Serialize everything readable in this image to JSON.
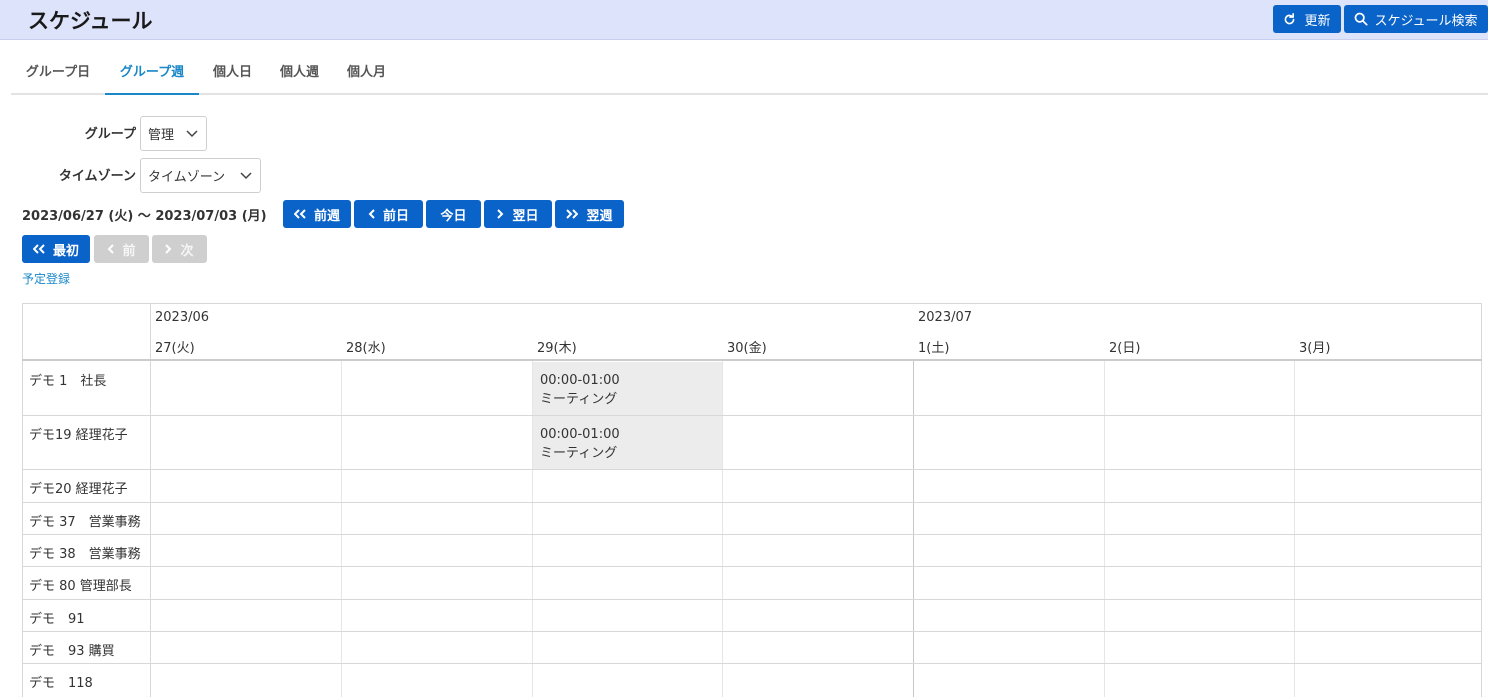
{
  "header": {
    "title": "スケジュール",
    "refresh_label": "更新",
    "search_label": "スケジュール検索"
  },
  "tabs": [
    {
      "label": "グループ日",
      "active": false
    },
    {
      "label": "グループ週",
      "active": true
    },
    {
      "label": "個人日",
      "active": false
    },
    {
      "label": "個人週",
      "active": false
    },
    {
      "label": "個人月",
      "active": false
    }
  ],
  "filters": {
    "group_label": "グループ",
    "group_value": "管理",
    "timezone_label": "タイムゾーン",
    "timezone_value": "タイムゾーン"
  },
  "nav": {
    "date_range": "2023/06/27 (火) ～ 2023/07/03 (月)",
    "prev_week": "前週",
    "prev_day": "前日",
    "today": "今日",
    "next_day": "翌日",
    "next_week": "翌週"
  },
  "paging": {
    "first": "最初",
    "prev": "前",
    "next": "次"
  },
  "register_link": "予定登録",
  "colors": {
    "primary": "#0a63c9",
    "header_bg": "#dde3fb",
    "active_tab": "#1a87c9",
    "event_bg": "#ececec",
    "disabled": "#cfcfcf"
  },
  "calendar": {
    "months": [
      "2023/06",
      "2023/07"
    ],
    "days": [
      "27(火)",
      "28(水)",
      "29(木)",
      "30(金)",
      "1(土)",
      "2(日)",
      "3(月)"
    ],
    "people": [
      "デモ 1　社長",
      "デモ19 経理花子",
      "デモ20 経理花子",
      "デモ 37　営業事務",
      "デモ 38　営業事務",
      "デモ 80 管理部長",
      "デモ　91",
      "デモ　93 購買",
      "デモ　118"
    ],
    "events": [
      {
        "person": 0,
        "day": 2,
        "time": "00:00-01:00",
        "title": "ミーティング"
      },
      {
        "person": 1,
        "day": 2,
        "time": "00:00-01:00",
        "title": "ミーティング"
      }
    ]
  }
}
